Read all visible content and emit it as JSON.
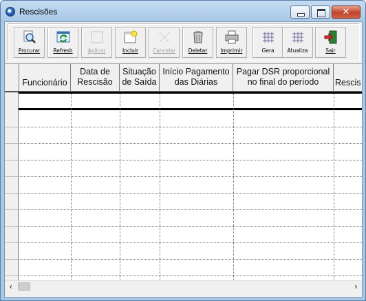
{
  "window": {
    "title": "Rescisões"
  },
  "title_controls": {
    "close_glyph": "✕"
  },
  "toolbar": {
    "buttons": [
      {
        "label": "Procurar",
        "icon": "search-icon",
        "enabled": true
      },
      {
        "label": "Refresh",
        "icon": "refresh-icon",
        "enabled": true
      },
      {
        "label": "Aplicar",
        "icon": "apply-icon",
        "enabled": false
      },
      {
        "label": "Incluir",
        "icon": "add-icon",
        "enabled": true
      },
      {
        "label": "Cancelar",
        "icon": "cancel-icon",
        "enabled": false
      },
      {
        "label": "Deletar",
        "icon": "trash-icon",
        "enabled": true
      },
      {
        "label": "Imprimir",
        "icon": "printer-icon",
        "enabled": true
      },
      {
        "label": "Gera",
        "icon": "grid-icon",
        "enabled": true
      },
      {
        "label": "Atualiza",
        "icon": "grid-icon",
        "enabled": true
      },
      {
        "label": "Sair",
        "icon": "exit-door-icon",
        "enabled": true
      }
    ]
  },
  "grid": {
    "headers": {
      "funcionario": "Funcionário",
      "data_rescisao_1": "Data de",
      "data_rescisao_2": "Rescisão",
      "situacao_1": "Situação",
      "situacao_2": "de Saída",
      "inicio_1": "Início Pagamento",
      "inicio_2": "das Diárias",
      "dsr_1": "Pagar DSR proporcional",
      "dsr_2": "no final do período",
      "rescis": "Rescis"
    },
    "rows": []
  },
  "scrollbar": {
    "left_arrow": "‹",
    "right_arrow": "›"
  },
  "colors": {
    "title_gradient_top": "#c4dbf2",
    "close_red": "#c0442b",
    "grid_line": "#6a6a6a"
  }
}
